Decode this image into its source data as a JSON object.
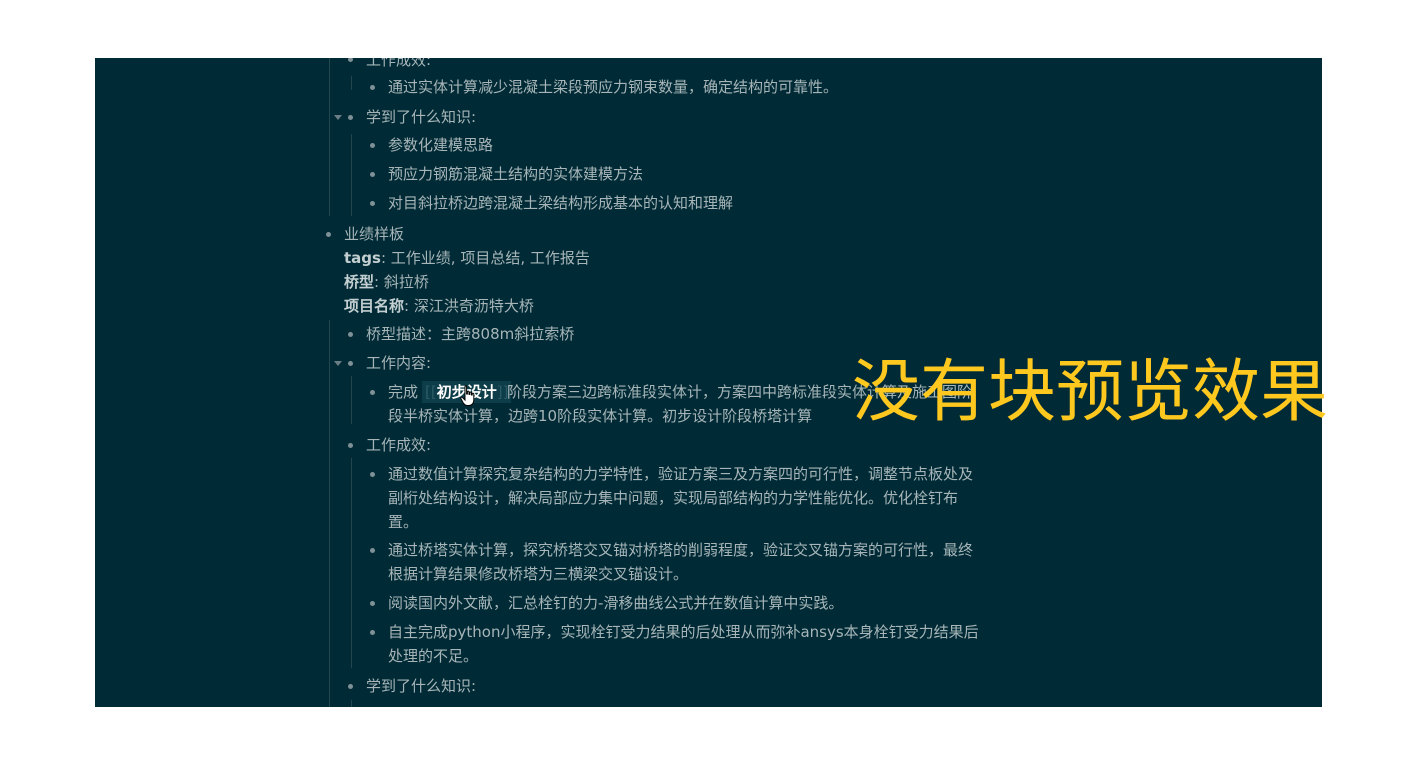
{
  "blocks": {
    "prev_result_label": "工作成效:",
    "prev_result_item": "通过实体计算减少混凝土梁段预应力钢束数量，确定结构的可靠性。",
    "prev_learned_label": "学到了什么知识:",
    "prev_learned_1": "参数化建模思路",
    "prev_learned_2": "预应力钢筋混凝土结构的实体建模方法",
    "prev_learned_3": "对目斜拉桥边跨混凝土梁结构形成基本的认知和理解",
    "template_title": "业绩样板",
    "props": {
      "tags_key": "tags",
      "tags_value": ": 工作业绩, 项目总结, 工作报告",
      "bridge_key": "桥型",
      "bridge_value": ": 斜拉桥",
      "project_key": "项目名称",
      "project_value": ": 深江洪奇沥特大桥"
    },
    "bridge_desc": "桥型描述：主跨808m斜拉索桥",
    "work_content_label": "工作内容:",
    "work_content_prefix": "完成",
    "work_content_ref": "初步设计",
    "work_content_rest": "阶段方案三边跨标准段实体计，方案四中跨标准段实体计算及施工图阶",
    "work_content_line2": "段半桥实体计算，边跨10阶段实体计算。初步设计阶段桥塔计算",
    "result_label": "工作成效:",
    "result_1_line1": "通过数值计算探究复杂结构的力学特性，验证方案三及方案四的可行性，调整节点板处及",
    "result_1_line2": "副桁处结构设计，解决局部应力集中问题，实现局部结构的力学性能优化。优化栓钉布",
    "result_1_line3": "置。",
    "result_2_line1": "通过桥塔实体计算，探究桥塔交叉锚对桥塔的削弱程度，验证交叉锚方案的可行性，最终",
    "result_2_line2": "根据计算结果修改桥塔为三横梁交叉锚设计。",
    "result_3": "阅读国内外文献，汇总栓钉的力-滑移曲线公式并在数值计算中实践。",
    "result_4_line1": "自主完成python小程序，实现栓钉受力结果的后处理从而弥补ansys本身栓钉受力结果后",
    "result_4_line2": "处理的不足。",
    "learned_label": "学到了什么知识:"
  },
  "overlay_caption": "没有块预览效果",
  "colors": {
    "background": "#002b36",
    "text": "#a7b5b8",
    "overlay": "#ffc81e"
  }
}
